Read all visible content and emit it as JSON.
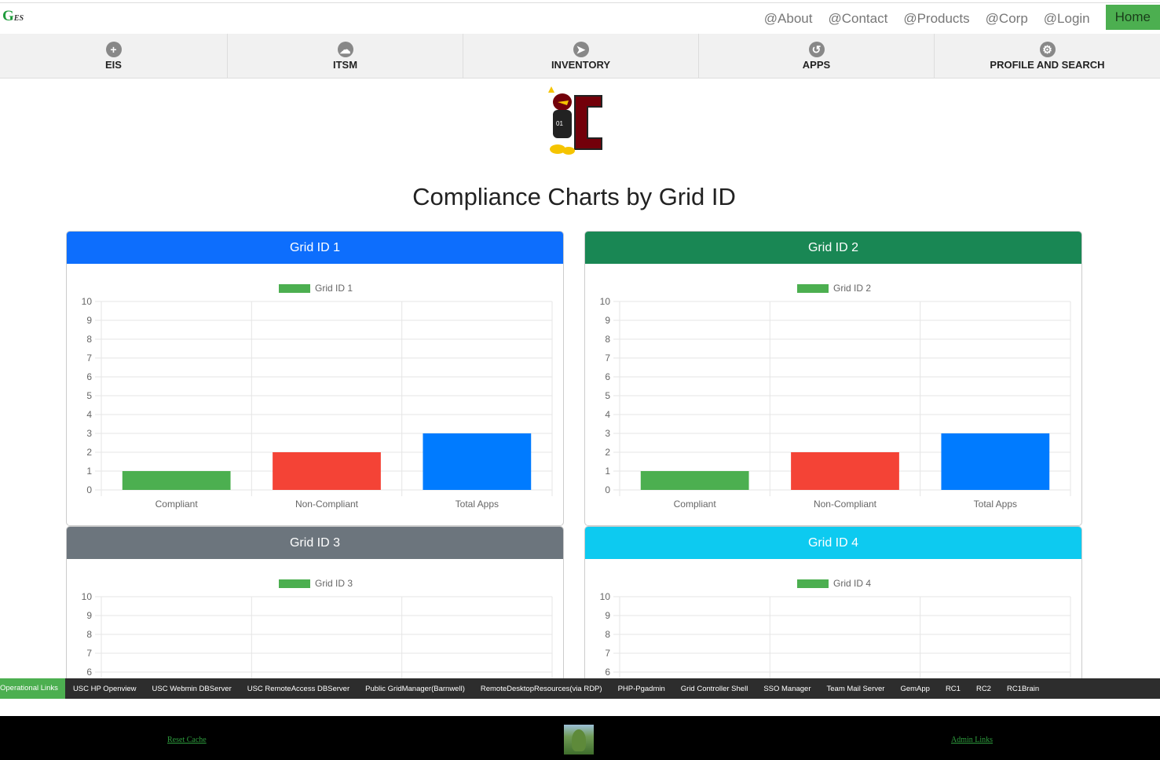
{
  "logo": {
    "main": "G",
    "sub": "ES"
  },
  "top_links": [
    "@About",
    "@Contact",
    "@Products",
    "@Corp",
    "@Login"
  ],
  "home_label": "Home",
  "nav": [
    {
      "label": "EIS",
      "icon": "plus-circle-icon",
      "glyph": "+"
    },
    {
      "label": "ITSM",
      "icon": "cloud-icon",
      "glyph": "☁"
    },
    {
      "label": "INVENTORY",
      "icon": "navigation-arrow-icon",
      "glyph": "➤"
    },
    {
      "label": "APPS",
      "icon": "undo-icon",
      "glyph": "↺"
    },
    {
      "label": "PROFILE AND SEARCH",
      "icon": "gear-icon",
      "glyph": "⚙"
    }
  ],
  "page_title": "Compliance Charts by Grid ID",
  "colors": {
    "compliant": "#4caf50",
    "non_compliant": "#f44336",
    "total": "#007bff"
  },
  "chart_data": [
    {
      "type": "bar",
      "title": "Grid ID 1",
      "header_color": "#0d6efd",
      "legend": "Grid ID 1",
      "categories": [
        "Compliant",
        "Non-Compliant",
        "Total Apps"
      ],
      "values": [
        1,
        2,
        3
      ],
      "ylim": [
        0,
        10
      ],
      "yticks": [
        0,
        1,
        2,
        3,
        4,
        5,
        6,
        7,
        8,
        9,
        10
      ]
    },
    {
      "type": "bar",
      "title": "Grid ID 2",
      "header_color": "#198754",
      "legend": "Grid ID 2",
      "categories": [
        "Compliant",
        "Non-Compliant",
        "Total Apps"
      ],
      "values": [
        1,
        2,
        3
      ],
      "ylim": [
        0,
        10
      ],
      "yticks": [
        0,
        1,
        2,
        3,
        4,
        5,
        6,
        7,
        8,
        9,
        10
      ]
    },
    {
      "type": "bar",
      "title": "Grid ID 3",
      "header_color": "#6c757d",
      "legend": "Grid ID 3",
      "categories": [],
      "values": [],
      "ylim": [
        0,
        10
      ],
      "yticks": [
        6,
        7,
        8,
        9,
        10
      ]
    },
    {
      "type": "bar",
      "title": "Grid ID 4",
      "header_color": "#0dcaf0",
      "legend": "Grid ID 4",
      "categories": [],
      "values": [],
      "ylim": [
        0,
        10
      ],
      "yticks": [
        6,
        7,
        8,
        9,
        10
      ]
    }
  ],
  "operational_links": [
    "Operational Links",
    "USC HP Openview",
    "USC Webmin DBServer",
    "USC RemoteAccess DBServer",
    "Public GridManager(Barnwell)",
    "RemoteDesktopResources(via RDP)",
    "PHP-Pgadmin",
    "Grid Controller Shell",
    "SSO Manager",
    "Team Mail Server",
    "GemApp",
    "RC1",
    "RC2",
    "RC1Brain"
  ],
  "footer": {
    "left_link": "Reset Cache",
    "right_link": "Admin Links"
  }
}
